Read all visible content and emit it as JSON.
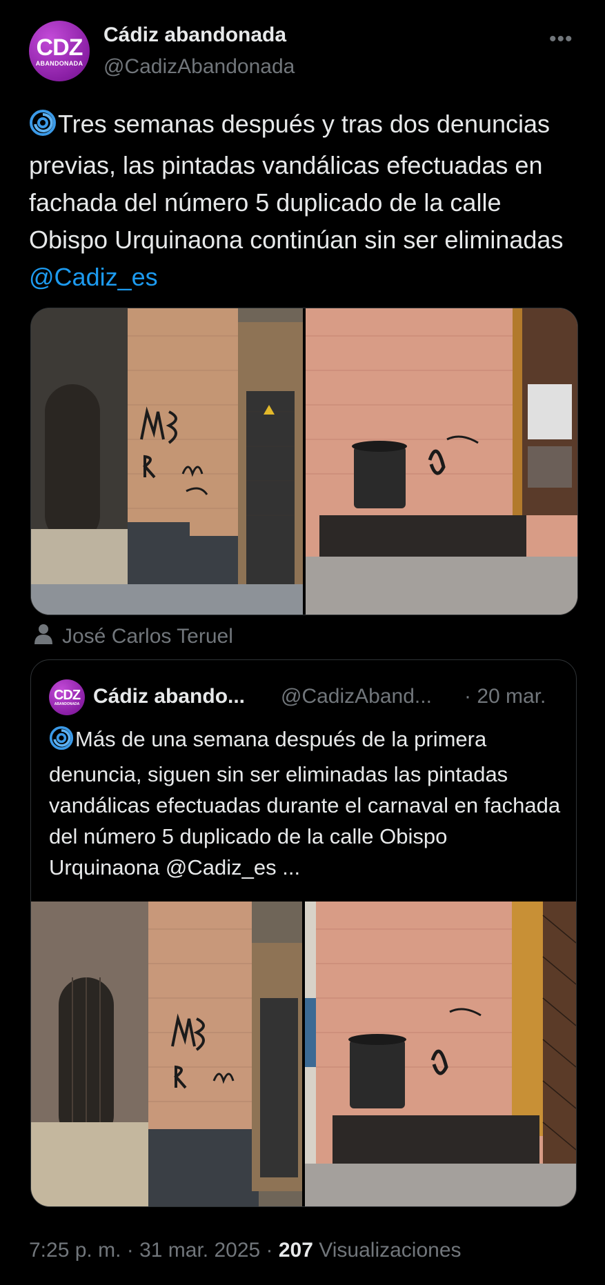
{
  "tweet": {
    "avatar_line1": "CDZ",
    "avatar_line2": "ABANDONADA",
    "display_name": "Cádiz abandonada",
    "handle": "@CadizAbandonada",
    "more_label": "•••",
    "text_main": "Tres semanas después y tras dos denuncias previas, las pintadas vandálicas efectuadas en fachada del número 5 duplicado de la calle Obispo Urquinaona continúan sin ser eliminadas ",
    "mention": "@Cadiz_es",
    "emoji_icon": "cyclone-icon",
    "photo_tag": "José Carlos Teruel",
    "time": "7:25 p. m.",
    "date": "31 mar. 2025",
    "views_count": "207",
    "views_label": "Visualizaciones"
  },
  "quote": {
    "avatar_line1": "CDZ",
    "avatar_line2": "ABANDONADA",
    "display_name": "Cádiz abando...",
    "handle": "@CadizAband...",
    "date": "· 20 mar.",
    "text": "Más de una semana después de la primera denuncia, siguen sin ser eliminadas las pintadas vandálicas efectuadas durante el carnaval en fachada del número 5 duplicado de la calle Obispo Urquinaona @Cadiz_es  ..."
  },
  "colors": {
    "background": "#000000",
    "text": "#e7e9ea",
    "muted": "#71767b",
    "link": "#1d9bf0",
    "border": "#2f3336",
    "avatar": "#8a1fa5"
  }
}
